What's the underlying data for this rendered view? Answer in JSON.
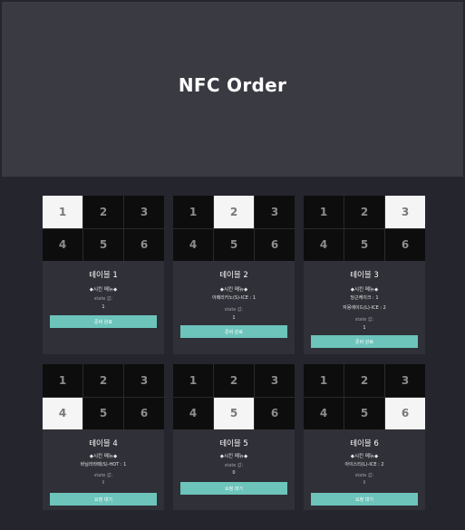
{
  "header": {
    "title": "NFC Order"
  },
  "tables": [
    {
      "numbers": [
        "1",
        "2",
        "3",
        "4",
        "5",
        "6"
      ],
      "active": 0,
      "title": "테이블 1",
      "menu_heading": "◆시킨 메뉴◆",
      "items": [],
      "state_label": "state 값:",
      "state_value": "1",
      "button": "준비 완료"
    },
    {
      "numbers": [
        "1",
        "2",
        "3",
        "4",
        "5",
        "6"
      ],
      "active": 1,
      "title": "테이블 2",
      "menu_heading": "◆시킨 메뉴◆",
      "items": [
        "아메리카노(S)-ICE : 1"
      ],
      "state_label": "state 값:",
      "state_value": "1",
      "button": "준비 완료"
    },
    {
      "numbers": [
        "1",
        "2",
        "3",
        "4",
        "5",
        "6"
      ],
      "active": 2,
      "title": "테이블 3",
      "menu_heading": "◆시킨 메뉴◆",
      "items": [
        "당근케이크 : 1",
        "자몽에이드(L)-ICE : 2"
      ],
      "state_label": "state 값:",
      "state_value": "1",
      "button": "준비 완료"
    },
    {
      "numbers": [
        "1",
        "2",
        "3",
        "4",
        "5",
        "6"
      ],
      "active": 3,
      "title": "테이블 4",
      "menu_heading": "◆시킨 메뉴◆",
      "items": [
        "바닐라라떼(S)-HOT : 1"
      ],
      "state_label": "state 값:",
      "state_value": "I",
      "button": "요청 대기"
    },
    {
      "numbers": [
        "1",
        "2",
        "3",
        "4",
        "5",
        "6"
      ],
      "active": 4,
      "title": "테이블 5",
      "menu_heading": "◆시킨 메뉴◆",
      "items": [],
      "state_label": "state 값:",
      "state_value": "0",
      "button": "요청 대기"
    },
    {
      "numbers": [
        "1",
        "2",
        "3",
        "4",
        "5",
        "6"
      ],
      "active": 5,
      "title": "테이블 6",
      "menu_heading": "◆시킨 메뉴◆",
      "items": [
        "아이스티(L)-ICE : 2"
      ],
      "state_label": "state 값:",
      "state_value": "I",
      "button": "요청 대기"
    }
  ]
}
